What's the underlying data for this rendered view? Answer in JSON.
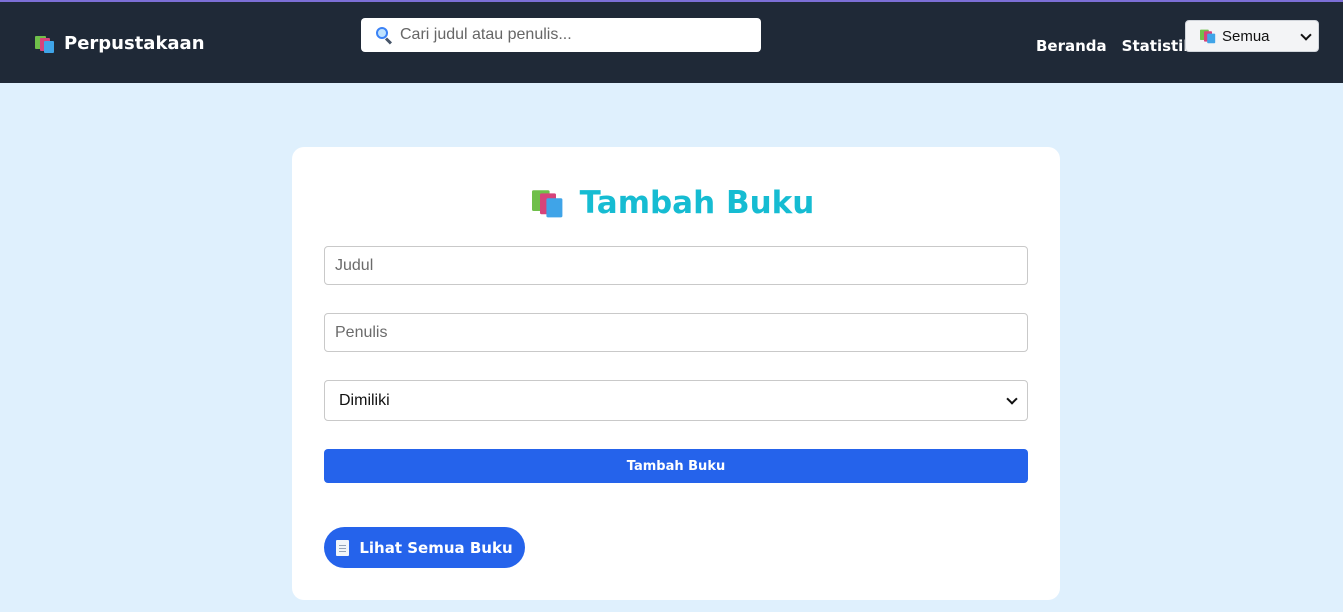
{
  "navbar": {
    "brand": "Perpustakaan",
    "brand_icon": "books-icon",
    "search": {
      "placeholder": "Cari judul atau penulis...",
      "value": "",
      "icon": "search-icon"
    },
    "links": [
      "Beranda",
      "Statistik"
    ],
    "filter": {
      "selected": "Semua",
      "icon": "books-icon"
    },
    "bg_color": "#1f2937"
  },
  "form": {
    "title": "Tambah Buku",
    "title_icon": "books-icon",
    "title_color": "#16bcd2",
    "judul_placeholder": "Judul",
    "penulis_placeholder": "Penulis",
    "status_selected": "Dimiliki",
    "submit_label": "Tambah Buku",
    "view_all_label": "Lihat Semua Buku",
    "view_all_icon": "document-icon",
    "accent_color": "#2563eb"
  },
  "page_bg": "#dff0fd"
}
